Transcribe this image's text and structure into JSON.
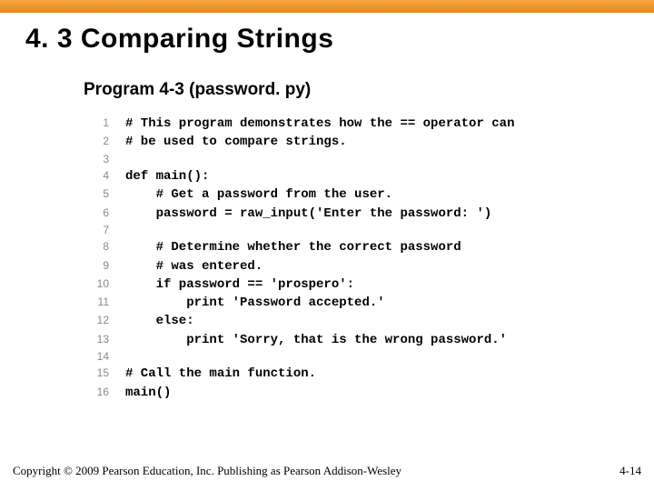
{
  "header": {
    "title": "4. 3 Comparing Strings",
    "subtitle": "Program 4-3  (password. py)"
  },
  "code": {
    "lines": [
      {
        "n": "1",
        "t": "# This program demonstrates how the == operator can"
      },
      {
        "n": "2",
        "t": "# be used to compare strings."
      },
      {
        "n": "3",
        "t": ""
      },
      {
        "n": "4",
        "t": "def main():"
      },
      {
        "n": "5",
        "t": "    # Get a password from the user."
      },
      {
        "n": "6",
        "t": "    password = raw_input('Enter the password: ')"
      },
      {
        "n": "7",
        "t": ""
      },
      {
        "n": "8",
        "t": "    # Determine whether the correct password"
      },
      {
        "n": "9",
        "t": "    # was entered."
      },
      {
        "n": "10",
        "t": "    if password == 'prospero':"
      },
      {
        "n": "11",
        "t": "        print 'Password accepted.'"
      },
      {
        "n": "12",
        "t": "    else:"
      },
      {
        "n": "13",
        "t": "        print 'Sorry, that is the wrong password.'"
      },
      {
        "n": "14",
        "t": ""
      },
      {
        "n": "15",
        "t": "# Call the main function."
      },
      {
        "n": "16",
        "t": "main()"
      }
    ]
  },
  "footer": {
    "copyright": "Copyright © 2009 Pearson Education, Inc. Publishing as Pearson Addison-Wesley",
    "page": "4-14"
  }
}
